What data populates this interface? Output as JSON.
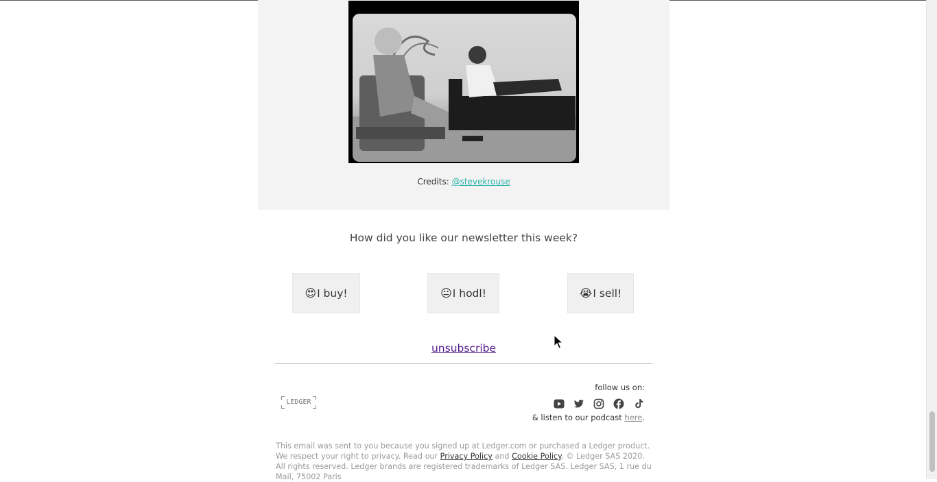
{
  "image_credit": {
    "label": "Credits: ",
    "link_text": "@stevekrouse"
  },
  "feedback": {
    "question": "How did you like our newsletter this week?",
    "options": [
      {
        "emoji": "😍",
        "label": "I buy!"
      },
      {
        "emoji": "😐",
        "label": "I hodl!"
      },
      {
        "emoji": "😭",
        "label": "I sell!"
      }
    ]
  },
  "unsubscribe": {
    "label": "unsubscribe"
  },
  "footer": {
    "logo_text": "LEDGER",
    "follow_label": "follow us on:",
    "socials": [
      "youtube-icon",
      "twitter-icon",
      "instagram-icon",
      "facebook-icon",
      "tiktok-icon"
    ],
    "podcast_prefix": "& listen to our podcast ",
    "podcast_link": "here",
    "podcast_suffix": ".",
    "legal": {
      "part1": "This email was sent to you because you signed up at Ledger.com or purchased a Ledger product. We respect your right to privacy. Read our ",
      "privacy_link": "Privacy Policy",
      "and": " and ",
      "cookie_link": "Cookie Policy",
      "part2": ". © Ledger SAS 2020. All rights reserved. Ledger brands are registered trademarks of Ledger SAS. Ledger SAS, 1 rue du Mail, 75002 Paris"
    }
  },
  "colors": {
    "link_teal": "#2bb3a9",
    "visited_link": "#551a8b",
    "panel_gray": "#f3f3f3"
  }
}
